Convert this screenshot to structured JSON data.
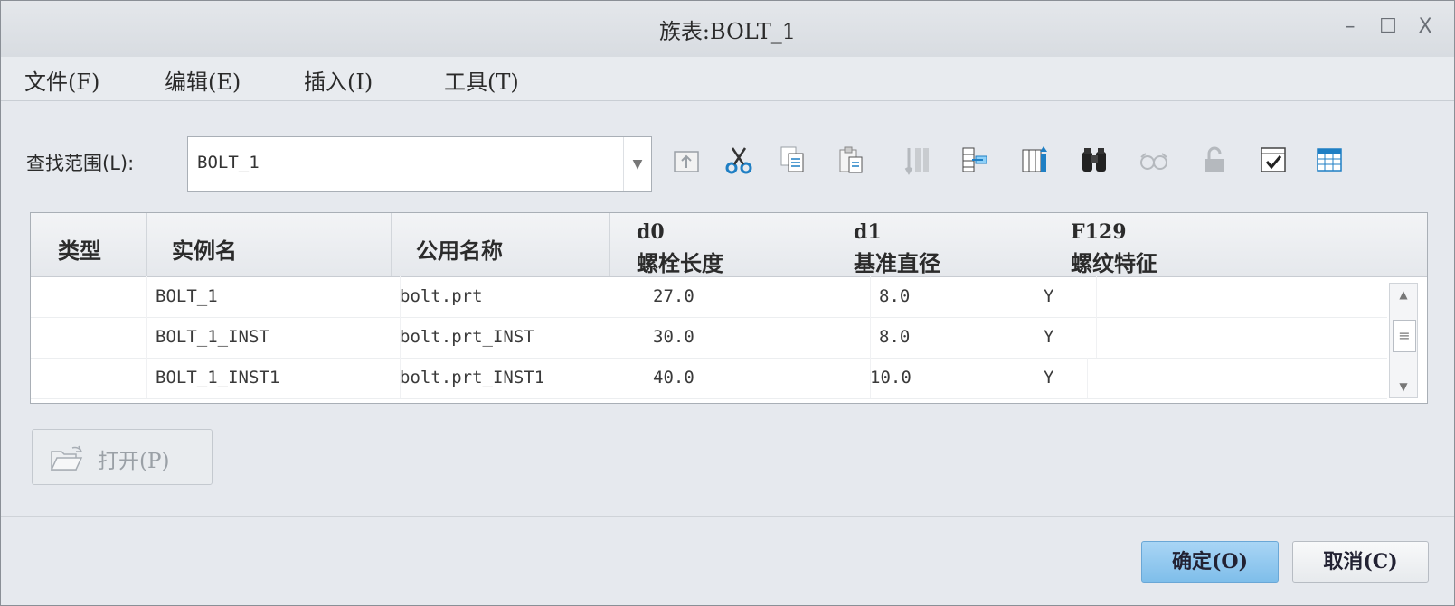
{
  "window": {
    "title": "族表:BOLT_1",
    "controls": {
      "minimize": "–",
      "maximize": "☐",
      "close": "X"
    }
  },
  "menu": [
    {
      "label": "文件(F)"
    },
    {
      "label": "编辑(E)"
    },
    {
      "label": "插入(I)"
    },
    {
      "label": "工具(T)"
    }
  ],
  "search": {
    "label": "查找范围(L):",
    "value": "BOLT_1"
  },
  "toolbar_icons": [
    "folder-up-icon",
    "cut-icon",
    "copy-icon",
    "paste-icon",
    "insert-row-icon",
    "insert-column-icon",
    "column-settings-icon",
    "find-icon",
    "preview-icon",
    "lock-icon",
    "verify-icon",
    "table-view-icon"
  ],
  "table": {
    "columns": [
      {
        "name": "type",
        "line1": "",
        "line2": "类型"
      },
      {
        "name": "instance",
        "line1": "",
        "line2": "实例名"
      },
      {
        "name": "common",
        "line1": "",
        "line2": "公用名称"
      },
      {
        "name": "d0",
        "line1": "d0",
        "line2": "螺栓长度"
      },
      {
        "name": "d1",
        "line1": "d1",
        "line2": "基准直径"
      },
      {
        "name": "f129",
        "line1": "F129",
        "line2": "螺纹特征"
      }
    ],
    "rows": [
      {
        "type": "",
        "instance": "BOLT_1",
        "common": "bolt.prt",
        "d0": "27.0",
        "d1": "8.0",
        "f129": "Y"
      },
      {
        "type": "",
        "instance": "BOLT_1_INST",
        "common": "bolt.prt_INST",
        "d0": "30.0",
        "d1": "8.0",
        "f129": "Y"
      },
      {
        "type": "",
        "instance": "BOLT_1_INST1",
        "common": "bolt.prt_INST1",
        "d0": "40.0",
        "d1": "10.0",
        "f129": "Y"
      }
    ]
  },
  "buttons": {
    "open": "打开(P)",
    "ok": "确定(O)",
    "cancel": "取消(C)"
  },
  "colors": {
    "ok_button": "#8cc8ef",
    "window_bg": "#e6e9ee",
    "icon_blue": "#1f7fc4"
  }
}
